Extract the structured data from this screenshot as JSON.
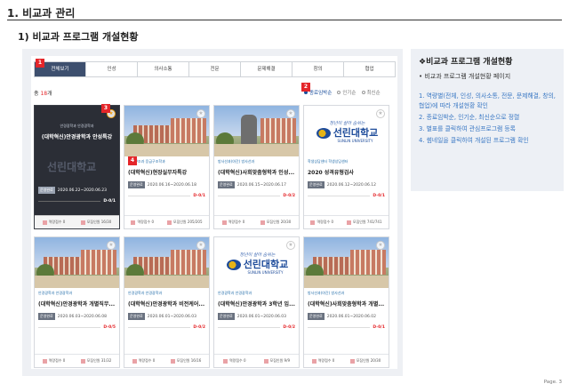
{
  "header": {
    "title": "1. 비교과 관리",
    "subtitle": "1) 비교과 프로그램 개설현황"
  },
  "tabs": [
    "전체보기",
    "인성",
    "의사소통",
    "전문",
    "문제해결",
    "창의",
    "협업"
  ],
  "summary": {
    "count_prefix": "총 ",
    "count_value": "18",
    "count_suffix": "개"
  },
  "sorts": [
    "종료임박순",
    "인기순",
    "최신순"
  ],
  "annotations": [
    "1",
    "2",
    "3",
    "4"
  ],
  "card_labels": {
    "status": "운영완료",
    "apply": "역량점수",
    "reserve": "모집인원"
  },
  "cards": [
    {
      "dept": "안경광학과 안경광학과",
      "title": "(대학혁신)안경광학과 안성특강",
      "period": "2020.06.22~2020.06.23",
      "dday": "D-0/1",
      "apply_count": "0",
      "reserve": "16/30",
      "thumb": "dark"
    },
    {
      "dept": "응급구조과 응급구조학과",
      "title": "(대학혁신)현장실무자특강",
      "period": "2020.06.16~2020.06.18",
      "dday": "D-0/1",
      "apply_count": "0",
      "reserve": "205/205",
      "thumb": "campus"
    },
    {
      "dept": "방사선과(야간) 방사선과",
      "title": "(대학혁신)사회맞춤형학과 인성...",
      "period": "2020.06.15~2020.06.17",
      "dday": "D-0/2",
      "apply_count": "0",
      "reserve": "20/30",
      "thumb": "rock"
    },
    {
      "dept": "학생상담센터 학생상담센터",
      "title": "2020 성격유형검사",
      "period": "2020.06.12~2020.06.12",
      "dday": "D-0/1",
      "apply_count": "0",
      "reserve": "741/741",
      "thumb": "logo"
    },
    {
      "dept": "안경광학과 안경광학과",
      "title": "(대학혁신)안경광학과 개별직무...",
      "period": "2020.06.03~2020.06.08",
      "dday": "D-0/5",
      "apply_count": "0",
      "reserve": "31/32",
      "thumb": "campus"
    },
    {
      "dept": "안경광학과 안경광학과",
      "title": "(대학혁신)안경광학과 비전케어...",
      "period": "2020.06.01~2020.06.03",
      "dday": "D-0/2",
      "apply_count": "0",
      "reserve": "16/16",
      "thumb": "campus"
    },
    {
      "dept": "안경광학과 안경광학과",
      "title": "(대학혁신)안경광학과 3학년 임...",
      "period": "2020.06.01~2020.06.03",
      "dday": "D-0/2",
      "apply_count": "0",
      "reserve": "9/9",
      "thumb": "logo"
    },
    {
      "dept": "방사선과(야간) 방사선과",
      "title": "(대학혁신)사회맞춤형학과 개별...",
      "period": "2020.06.01~2020.06.02",
      "dday": "D-0/1",
      "apply_count": "0",
      "reserve": "20/30",
      "thumb": "campus"
    }
  ],
  "logo": {
    "script": "청년이 살아 숨쉬는",
    "name": "선린대학교",
    "en": "SUNLIN UNIVERSITY"
  },
  "dark_watermark": "선린대학교",
  "side": {
    "title": "❖비교과 프로그램 개설현황",
    "line": "• 비교과 프로그램 개설현황 페이지",
    "items": [
      "1. 역량별(전체, 인성, 의사소통, 전문, 문제해결, 창의, 협업)에 따라 개설현황 확인",
      "2. 종료임박순, 인기순, 최신순으로 정렬",
      "3. 별표를 클릭하여 관심프로그램 등록",
      "4. 썸네일을 클릭하여 개설된 프로그램 확인"
    ]
  },
  "page_no": "Page. 3",
  "colors": {
    "accent": "#3d4f6e",
    "annotation": "#e4262a",
    "side_text": "#3a78c4"
  }
}
